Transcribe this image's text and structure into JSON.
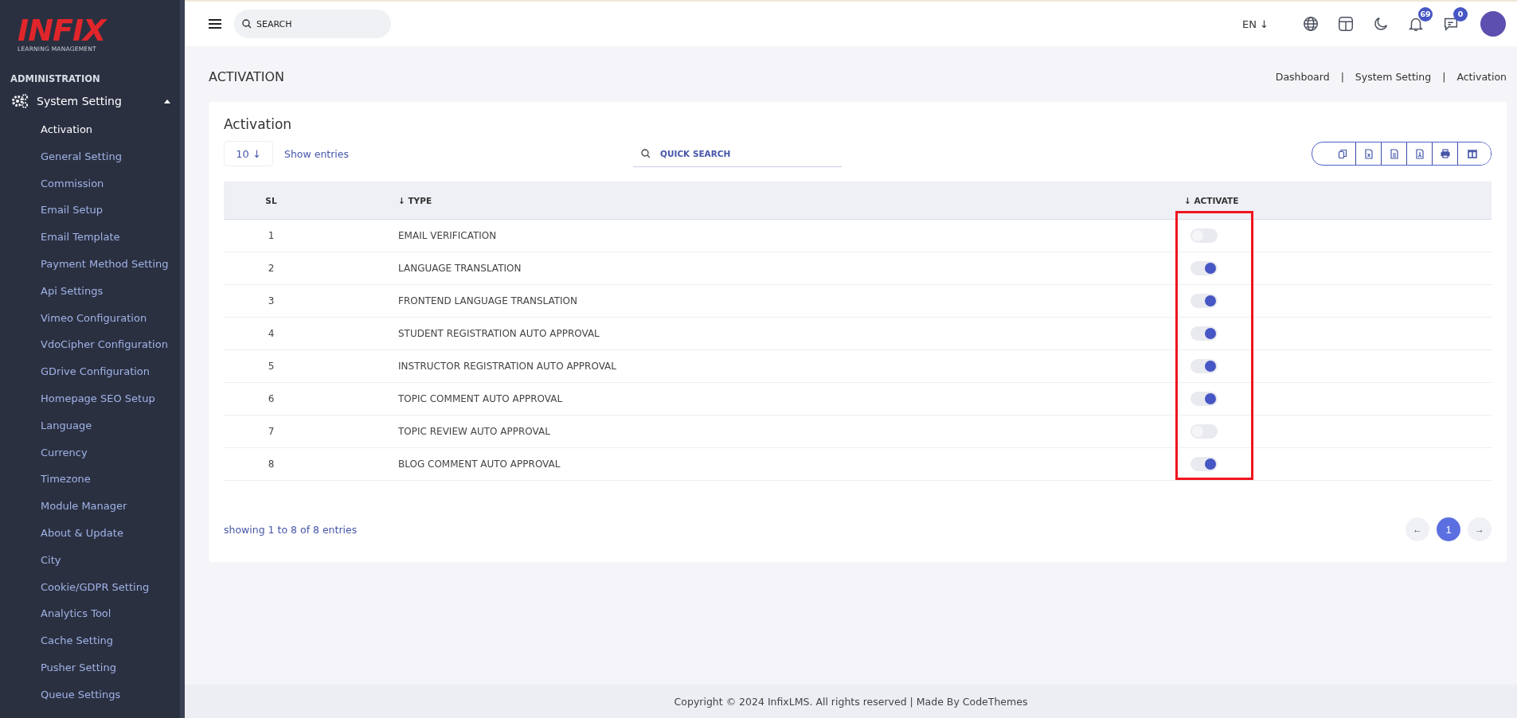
{
  "sidebar": {
    "logo": {
      "word": "INFIX",
      "tagline": "LEARNING MANAGEMENT"
    },
    "section_title": "ADMINISTRATION",
    "group": {
      "label": "System Setting",
      "expanded": true,
      "items": [
        {
          "label": "Activation",
          "selected": true
        },
        {
          "label": "General Setting",
          "selected": false
        },
        {
          "label": "Commission",
          "selected": false
        },
        {
          "label": "Email Setup",
          "selected": false
        },
        {
          "label": "Email Template",
          "selected": false
        },
        {
          "label": "Payment Method Setting",
          "selected": false
        },
        {
          "label": "Api Settings",
          "selected": false
        },
        {
          "label": "Vimeo Configuration",
          "selected": false
        },
        {
          "label": "VdoCipher Configuration",
          "selected": false
        },
        {
          "label": "GDrive Configuration",
          "selected": false
        },
        {
          "label": "Homepage SEO Setup",
          "selected": false
        },
        {
          "label": "Language",
          "selected": false
        },
        {
          "label": "Currency",
          "selected": false
        },
        {
          "label": "Timezone",
          "selected": false
        },
        {
          "label": "Module Manager",
          "selected": false
        },
        {
          "label": "About & Update",
          "selected": false
        },
        {
          "label": "City",
          "selected": false
        },
        {
          "label": "Cookie/GDPR Setting",
          "selected": false
        },
        {
          "label": "Analytics Tool",
          "selected": false
        },
        {
          "label": "Cache Setting",
          "selected": false
        },
        {
          "label": "Pusher Setting",
          "selected": false
        },
        {
          "label": "Queue Settings",
          "selected": false
        }
      ]
    }
  },
  "topbar": {
    "search": {
      "placeholder": "SEARCH"
    },
    "language": "EN ↓",
    "notifications_badge": "69",
    "messages_badge": "0"
  },
  "page": {
    "title": "ACTIVATION",
    "breadcrumb": [
      {
        "label": "Dashboard",
        "separator": "|"
      },
      {
        "label": "System Setting",
        "separator": "|"
      },
      {
        "label": "Activation"
      }
    ]
  },
  "card": {
    "title": "Activation",
    "page_size": "10 ↓",
    "show_entries": "Show entries",
    "quick_search": {
      "placeholder": "QUICK SEARCH"
    },
    "export_buttons": [
      {
        "kind": "copy"
      },
      {
        "kind": "excel"
      },
      {
        "kind": "csv"
      },
      {
        "kind": "pdf"
      },
      {
        "kind": "print"
      },
      {
        "kind": "columns"
      }
    ],
    "table": {
      "columns": [
        {
          "label": "SL"
        },
        {
          "label": "↓ TYPE"
        },
        {
          "label": "↓ ACTIVATE"
        }
      ],
      "activate_column_highlighted": true,
      "rows": [
        {
          "sl": "1",
          "type": "EMAIL VERIFICATION",
          "activated": false
        },
        {
          "sl": "2",
          "type": "LANGUAGE TRANSLATION",
          "activated": true
        },
        {
          "sl": "3",
          "type": "FRONTEND LANGUAGE TRANSLATION",
          "activated": true
        },
        {
          "sl": "4",
          "type": "STUDENT REGISTRATION AUTO APPROVAL",
          "activated": true
        },
        {
          "sl": "5",
          "type": "INSTRUCTOR REGISTRATION AUTO APPROVAL",
          "activated": true
        },
        {
          "sl": "6",
          "type": "TOPIC COMMENT AUTO APPROVAL",
          "activated": true
        },
        {
          "sl": "7",
          "type": "TOPIC REVIEW AUTO APPROVAL",
          "activated": false
        },
        {
          "sl": "8",
          "type": "BLOG COMMENT AUTO APPROVAL",
          "activated": true
        }
      ]
    },
    "summary": "showing 1 to 8 of 8 entries",
    "pagination": [
      {
        "label": "←",
        "kind": "prev",
        "selected": false
      },
      {
        "label": "1",
        "kind": "page",
        "selected": true
      },
      {
        "label": "→",
        "kind": "next",
        "selected": false
      }
    ]
  },
  "footer": "Copyright © 2024 InfixLMS. All rights reserved | Made By CodeThemes"
}
